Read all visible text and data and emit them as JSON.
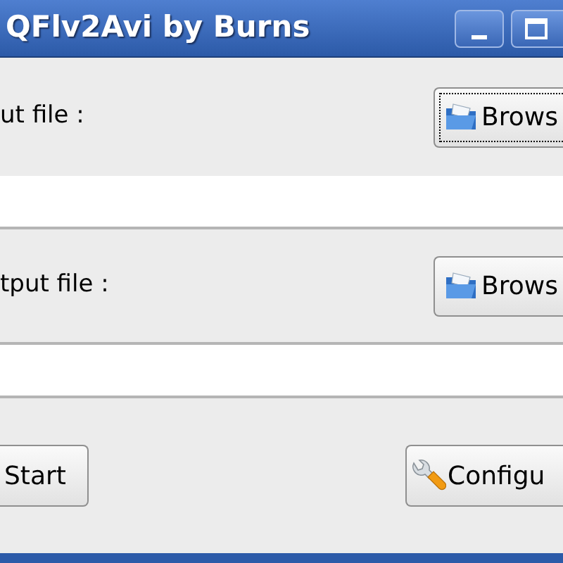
{
  "window": {
    "title": "QFlv2Avi by Burns"
  },
  "sections": [
    {
      "label": "ut file :",
      "button": {
        "label": "Brows",
        "focused": true
      }
    },
    {
      "label": "tput file :",
      "button": {
        "label": "Brows",
        "focused": false
      }
    }
  ],
  "actions": [
    {
      "label": "Start",
      "kind": "start"
    },
    {
      "label": "Configu",
      "kind": "configure"
    }
  ]
}
